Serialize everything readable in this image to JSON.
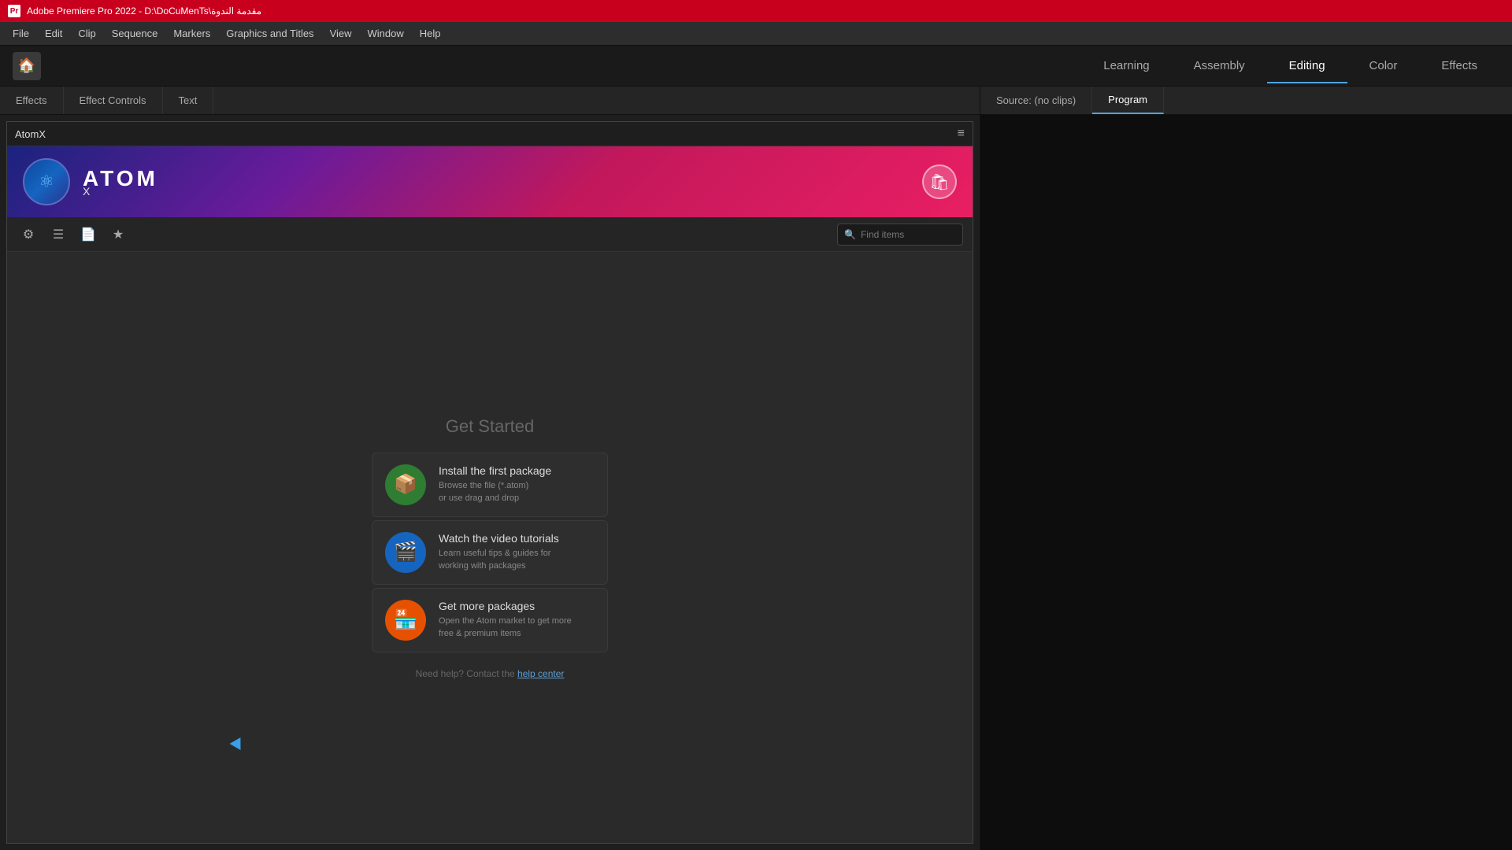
{
  "titleBar": {
    "appName": "Adobe Premiere Pro 2022 - D:\\DoCuMenTs\\مقدمة الندوة",
    "icon": "Pr"
  },
  "menuBar": {
    "items": [
      "File",
      "Edit",
      "Clip",
      "Sequence",
      "Markers",
      "Graphics and Titles",
      "View",
      "Window",
      "Help"
    ]
  },
  "workspaceBar": {
    "homeLabel": "🏠",
    "tabs": [
      {
        "label": "Learning",
        "active": false
      },
      {
        "label": "Assembly",
        "active": false
      },
      {
        "label": "Editing",
        "active": true
      },
      {
        "label": "Color",
        "active": false
      },
      {
        "label": "Effects",
        "active": false
      }
    ]
  },
  "leftPanel": {
    "tabs": [
      "Effects",
      "Effect Controls",
      "Text"
    ]
  },
  "atomxPanel": {
    "title": "AtomX",
    "menuIcon": "≡",
    "banner": {
      "logoText": "ATOM",
      "subText": "X",
      "cartIcon": "🛍"
    },
    "toolbar": {
      "tools": [
        "⚙",
        "☰",
        "📄",
        "★"
      ],
      "searchPlaceholder": "Find items"
    },
    "content": {
      "getStartedTitle": "Get Started",
      "actions": [
        {
          "icon": "📦",
          "iconColor": "green",
          "title": "Install the first package",
          "description": "Browse the file (*.atom)\nor use drag and drop"
        },
        {
          "icon": "🎬",
          "iconColor": "blue",
          "title": "Watch the video tutorials",
          "description": "Learn useful tips & guides for\nworking with packages"
        },
        {
          "icon": "🏪",
          "iconColor": "orange",
          "title": "Get more packages",
          "description": "Open the Atom market to get more\nfree & premium items"
        }
      ],
      "helpText": "Need help? Contact the ",
      "helpLinkText": "help center"
    }
  },
  "rightPanel": {
    "tabs": [
      {
        "label": "Source: (no clips)",
        "active": false
      },
      {
        "label": "Program",
        "active": true
      }
    ]
  }
}
